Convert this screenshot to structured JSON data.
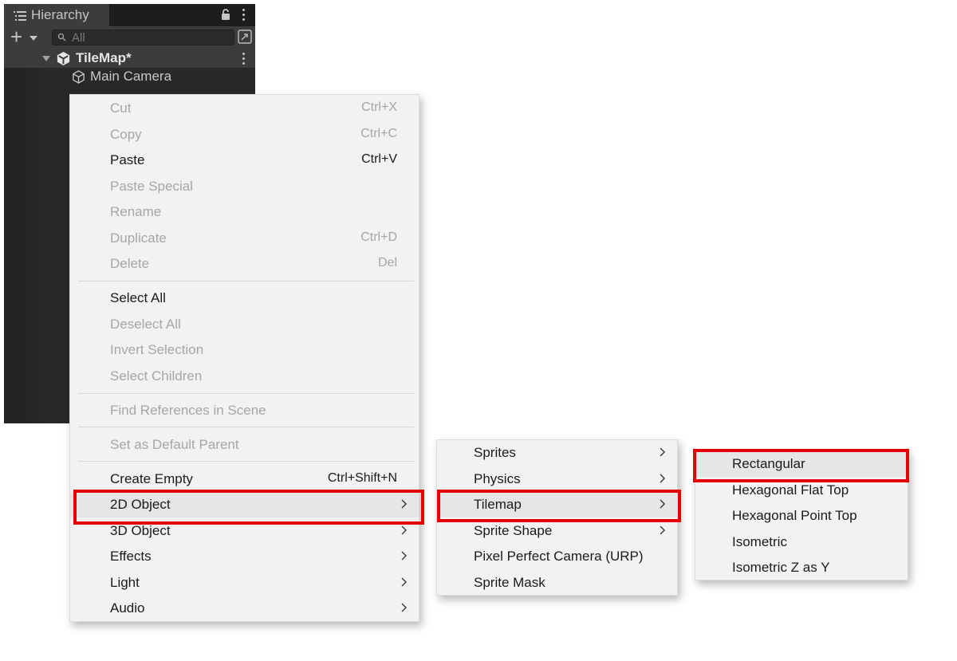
{
  "hierarchy": {
    "tab_title": "Hierarchy",
    "search": {
      "placeholder": "All",
      "value": ""
    },
    "scene": {
      "label": "TileMap*"
    },
    "items": [
      {
        "label": "Main Camera"
      }
    ]
  },
  "context_menu": {
    "items": [
      {
        "label": "Cut",
        "shortcut": "Ctrl+X",
        "enabled": false
      },
      {
        "label": "Copy",
        "shortcut": "Ctrl+C",
        "enabled": false
      },
      {
        "label": "Paste",
        "shortcut": "Ctrl+V",
        "enabled": true
      },
      {
        "label": "Paste Special",
        "shortcut": "",
        "enabled": false
      },
      {
        "label": "Rename",
        "shortcut": "",
        "enabled": false
      },
      {
        "label": "Duplicate",
        "shortcut": "Ctrl+D",
        "enabled": false
      },
      {
        "label": "Delete",
        "shortcut": "Del",
        "enabled": false
      },
      {
        "label": "Select All",
        "shortcut": "",
        "enabled": true
      },
      {
        "label": "Deselect All",
        "shortcut": "",
        "enabled": false
      },
      {
        "label": "Invert Selection",
        "shortcut": "",
        "enabled": false
      },
      {
        "label": "Select Children",
        "shortcut": "",
        "enabled": false
      },
      {
        "label": "Find References in Scene",
        "shortcut": "",
        "enabled": false
      },
      {
        "label": "Set as Default Parent",
        "shortcut": "",
        "enabled": false
      },
      {
        "label": "Create Empty",
        "shortcut": "Ctrl+Shift+N",
        "enabled": true
      },
      {
        "label": "2D Object",
        "submenu": true,
        "enabled": true,
        "highlighted": true
      },
      {
        "label": "3D Object",
        "submenu": true,
        "enabled": true
      },
      {
        "label": "Effects",
        "submenu": true,
        "enabled": true
      },
      {
        "label": "Light",
        "submenu": true,
        "enabled": true
      },
      {
        "label": "Audio",
        "submenu": true,
        "enabled": true
      }
    ]
  },
  "submenu_2d": {
    "items": [
      {
        "label": "Sprites",
        "submenu": true
      },
      {
        "label": "Physics",
        "submenu": true
      },
      {
        "label": "Tilemap",
        "submenu": true,
        "highlighted": true
      },
      {
        "label": "Sprite Shape",
        "submenu": true
      },
      {
        "label": "Pixel Perfect Camera (URP)",
        "submenu": false
      },
      {
        "label": "Sprite Mask",
        "submenu": false
      }
    ]
  },
  "submenu_tilemap": {
    "items": [
      {
        "label": "Rectangular",
        "highlighted": true
      },
      {
        "label": "Hexagonal Flat Top"
      },
      {
        "label": "Hexagonal Point Top"
      },
      {
        "label": "Isometric"
      },
      {
        "label": "Isometric Z as Y"
      }
    ]
  },
  "colors": {
    "highlight_box": "#e60000",
    "panel_dark": "#282828",
    "menu_bg": "#f2f2f2",
    "disabled_text": "#a6a6a6"
  }
}
